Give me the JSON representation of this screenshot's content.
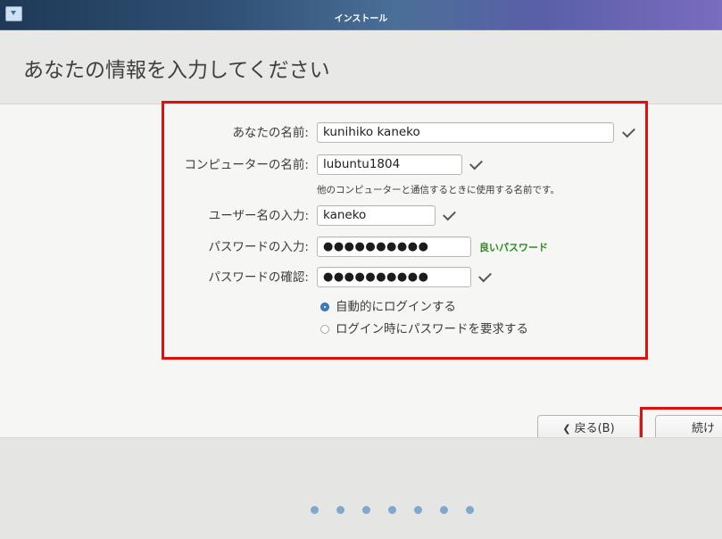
{
  "window": {
    "title": "インストール",
    "app_icon": "installer-icon"
  },
  "header": {
    "title": "あなたの情報を入力してください"
  },
  "form": {
    "name": {
      "label": "あなたの名前:",
      "value": "kunihiko kaneko",
      "valid_icon": "check-icon"
    },
    "computer": {
      "label": "コンピューターの名前:",
      "value": "lubuntu1804",
      "valid_icon": "check-icon",
      "hint": "他のコンピューターと通信するときに使用する名前です。"
    },
    "username": {
      "label": "ユーザー名の入力:",
      "value": "kaneko",
      "valid_icon": "check-icon"
    },
    "password": {
      "label": "パスワードの入力:",
      "value": "●●●●●●●●●●",
      "strength": "良いパスワード",
      "strength_color": "#2e8b1e"
    },
    "confirm": {
      "label": "パスワードの確認:",
      "value": "●●●●●●●●●●",
      "valid_icon": "check-icon"
    },
    "login_options": [
      {
        "label": "自動的にログインする",
        "selected": true
      },
      {
        "label": "ログイン時にパスワードを要求する",
        "selected": false
      }
    ]
  },
  "buttons": {
    "back": "戻る(B)",
    "back_icon": "chevron-left-icon",
    "continue": "続け"
  },
  "progress": {
    "step_count": 7
  },
  "colors": {
    "highlight": "#e01010",
    "accent": "#3d7ec0"
  }
}
